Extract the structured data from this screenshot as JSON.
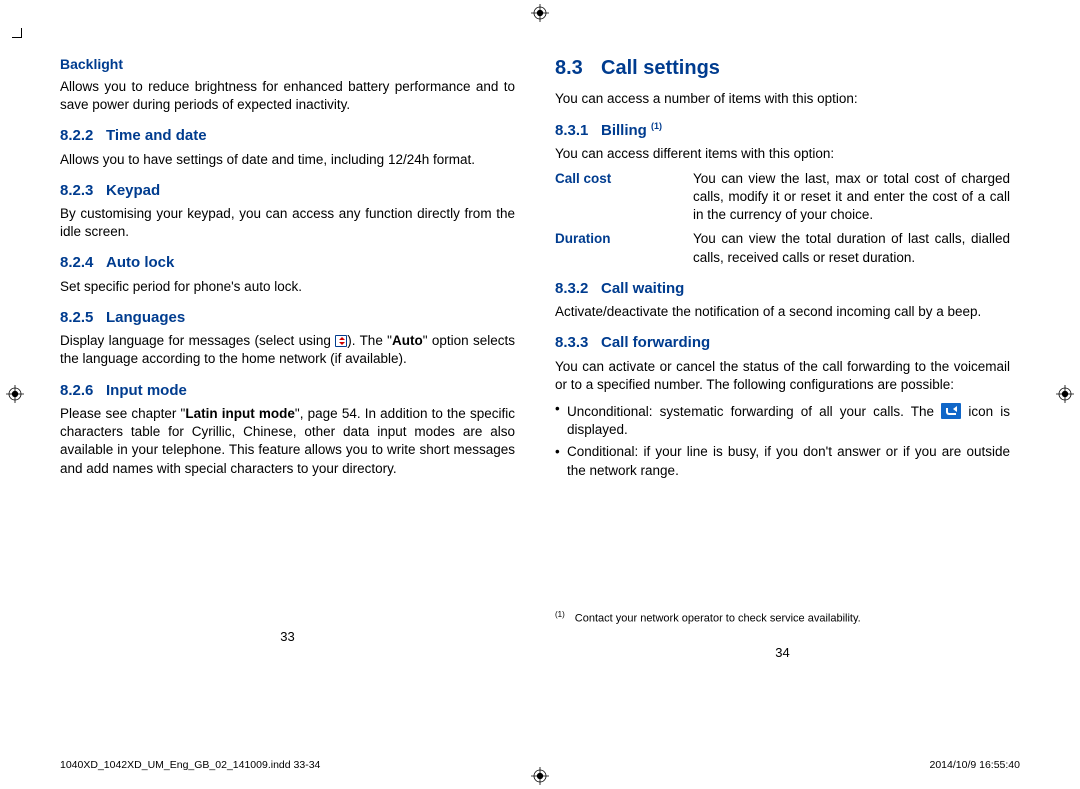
{
  "left": {
    "backlight_h": "Backlight",
    "backlight_p": "Allows you to reduce brightness for enhanced battery performance and to save power during periods of expected inactivity.",
    "s822n": "8.2.2",
    "s822t": "Time and date",
    "s822p": "Allows you to have settings of date and time, including 12/24h format.",
    "s823n": "8.2.3",
    "s823t": "Keypad",
    "s823p": "By customising your keypad, you can access any function directly from the idle screen.",
    "s824n": "8.2.4",
    "s824t": "Auto lock",
    "s824p": "Set specific period for phone's auto lock.",
    "s825n": "8.2.5",
    "s825t": "Languages",
    "s825p1": "Display language for messages (select using ",
    "s825p2": "). The \"",
    "s825auto": "Auto",
    "s825p3": "\" option selects the language according to the home network (if available).",
    "s826n": "8.2.6",
    "s826t": "Input mode",
    "s826p1": "Please see chapter \"",
    "s826bold": "Latin input mode",
    "s826p2": "\", page 54. In addition to the specific characters table for Cyrillic, Chinese, other data input modes are also available in your telephone. This feature allows you to write short messages and add names with special characters to your directory.",
    "pagenum": "33"
  },
  "right": {
    "s83n": "8.3",
    "s83t": "Call settings",
    "s83p": "You can access a number of items with this option:",
    "s831n": "8.3.1",
    "s831t": "Billing ",
    "s831sup": "(1)",
    "s831p": "You can access different items with this option:",
    "cc_term": "Call cost",
    "cc_def": "You can view the last, max or total cost of charged calls, modify it or reset it and enter the cost of a call in the currency of your choice.",
    "dur_term": "Duration",
    "dur_def": "You can view the total duration of last calls, dialled calls, received calls or reset duration.",
    "s832n": "8.3.2",
    "s832t": "Call waiting",
    "s832p": "Activate/deactivate the notification of a second incoming call by a beep.",
    "s833n": "8.3.3",
    "s833t": "Call forwarding",
    "s833p": "You can activate or cancel the status of the call forwarding to the voicemail or to a specified number. The following configurations are possible:",
    "b1a": "Unconditional: systematic forwarding of all your calls. The ",
    "b1b": " icon is displayed.",
    "b2": "Conditional: if your line is busy, if you don't answer or if you are outside the network range.",
    "fn_sup": "(1)",
    "fn_txt": "Contact your network operator to check service availability.",
    "pagenum": "34"
  },
  "meta": {
    "file": "1040XD_1042XD_UM_Eng_GB_02_141009.indd   33-34",
    "date": "2014/10/9   16:55:40"
  }
}
